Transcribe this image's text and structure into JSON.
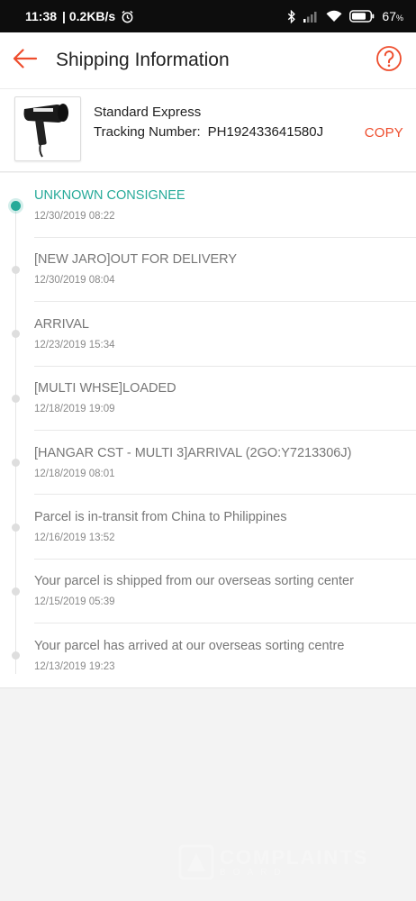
{
  "status_bar": {
    "time": "11:38",
    "net_speed": "| 0.2KB/s",
    "battery": "67",
    "battery_unit": "%",
    "icons": [
      "alarm-icon",
      "bluetooth-icon",
      "signal-icon",
      "wifi-icon",
      "battery-icon"
    ]
  },
  "header": {
    "title": "Shipping Information",
    "back_icon": "arrow-left-icon",
    "help_icon": "question-circle-icon"
  },
  "shipment": {
    "method": "Standard Express",
    "tracking_label": "Tracking Number:",
    "tracking_number": "PH192433641580J",
    "copy_label": "COPY",
    "thumb_logo_text": "POLICE"
  },
  "colors": {
    "accent": "#ee4d2d",
    "active": "#26aa99"
  },
  "timeline": [
    {
      "title": "UNKNOWN CONSIGNEE",
      "time": "12/30/2019 08:22",
      "active": true
    },
    {
      "title": "[NEW JARO]OUT FOR DELIVERY",
      "time": "12/30/2019 08:04",
      "active": false
    },
    {
      "title": "ARRIVAL",
      "time": "12/23/2019 15:34",
      "active": false
    },
    {
      "title": "[MULTI WHSE]LOADED",
      "time": "12/18/2019 19:09",
      "active": false
    },
    {
      "title": "[HANGAR CST - MULTI 3]ARRIVAL (2GO:Y7213306J)",
      "time": "12/18/2019 08:01",
      "active": false
    },
    {
      "title": "Parcel is in-transit from China to Philippines",
      "time": "12/16/2019 13:52",
      "active": false
    },
    {
      "title": "Your parcel is shipped from our overseas sorting center",
      "time": "12/15/2019 05:39",
      "active": false
    },
    {
      "title": "Your parcel has arrived at our overseas sorting centre",
      "time": "12/13/2019 19:23",
      "active": false
    }
  ],
  "watermark": {
    "line1": "COMPLAINTS",
    "line2": "BOARD"
  }
}
